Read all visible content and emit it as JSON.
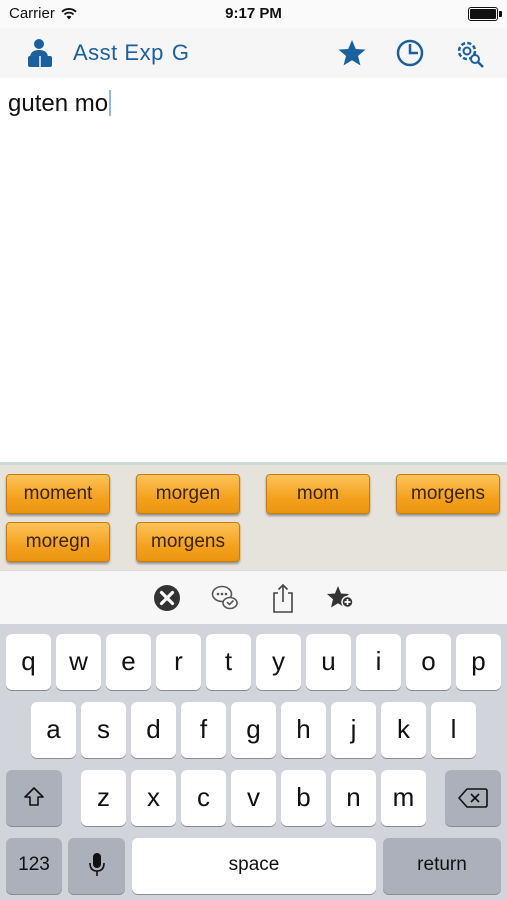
{
  "status_bar": {
    "carrier": "Carrier",
    "time": "9:17 PM"
  },
  "nav": {
    "title_part1": "Asst Exp",
    "title_part2": "G",
    "icons": [
      "people-icon",
      "star-icon",
      "history-icon",
      "settings-search-icon"
    ]
  },
  "editor": {
    "text": "guten mo"
  },
  "suggestions": [
    "moment",
    "morgen",
    "mom",
    "morgens",
    "moregn",
    "morgens"
  ],
  "toolbar": {
    "icons": [
      "clear-icon",
      "chat-bubbles-icon",
      "share-icon",
      "add-favorite-icon"
    ]
  },
  "keyboard": {
    "row1": [
      "q",
      "w",
      "e",
      "r",
      "t",
      "y",
      "u",
      "i",
      "o",
      "p"
    ],
    "row2": [
      "a",
      "s",
      "d",
      "f",
      "g",
      "h",
      "j",
      "k",
      "l"
    ],
    "row3": [
      "z",
      "x",
      "c",
      "v",
      "b",
      "n",
      "m"
    ],
    "numbers_label": "123",
    "space_label": "space",
    "return_label": "return"
  },
  "colors": {
    "accent": "#1a5f9e",
    "chip": "#f3a21d",
    "keyboard_bg": "#d1d4da"
  }
}
